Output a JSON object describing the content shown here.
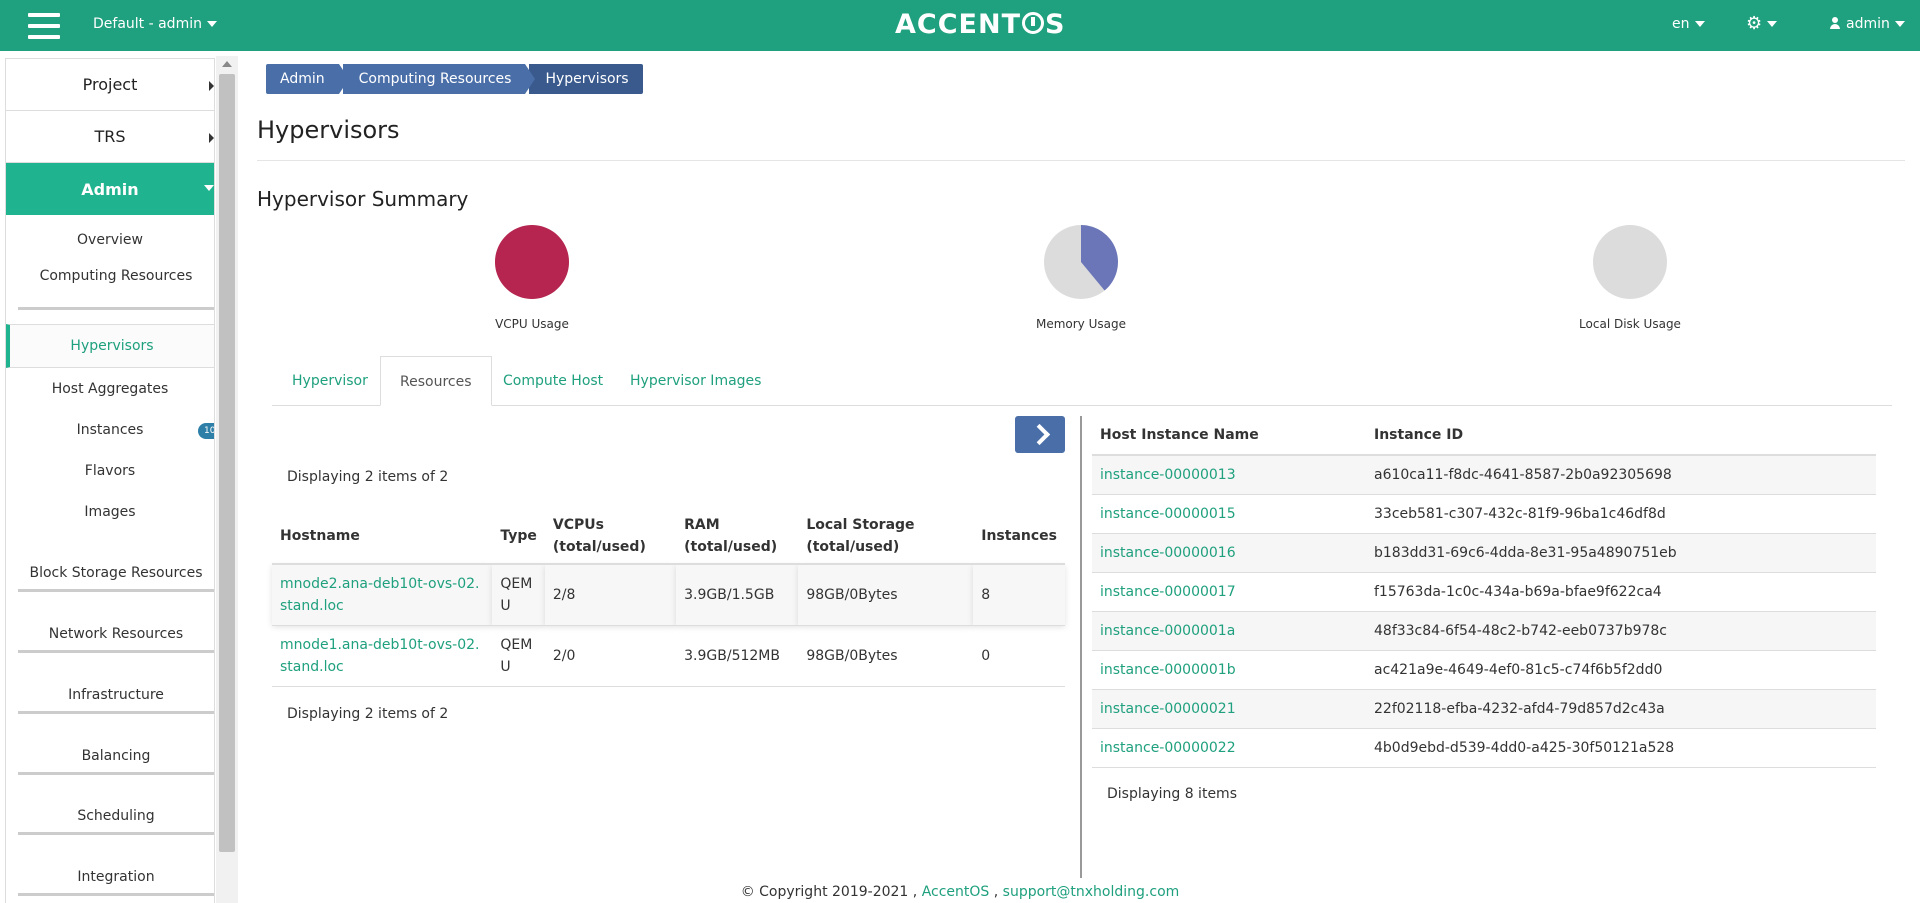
{
  "topbar": {
    "project": "Default - admin",
    "brand": "ACCENTOS",
    "brand_left": "ACCENT",
    "brand_right": "S",
    "language": "en",
    "user": "admin",
    "color": "#1fa07e"
  },
  "sidebar": {
    "sections": [
      {
        "label": "Project"
      },
      {
        "label": "TRS"
      }
    ],
    "active_section": "Admin",
    "items": [
      {
        "label": "Overview"
      },
      {
        "label": "Computing Resources"
      },
      {
        "label": "Hypervisors"
      },
      {
        "label": "Host Aggregates"
      },
      {
        "label": "Instances",
        "badge": "10"
      },
      {
        "label": "Flavors"
      },
      {
        "label": "Images"
      },
      {
        "label": "Block Storage Resources"
      },
      {
        "label": "Network Resources"
      },
      {
        "label": "Infrastructure"
      },
      {
        "label": "Balancing"
      },
      {
        "label": "Scheduling"
      },
      {
        "label": "Integration"
      }
    ]
  },
  "breadcrumb": [
    "Admin",
    "Computing Resources",
    "Hypervisors"
  ],
  "page_title": "Hypervisors",
  "summary": {
    "title": "Hypervisor Summary",
    "charts": [
      {
        "label": "VCPU Usage",
        "used_fraction": 1.0,
        "color": "#b5254f"
      },
      {
        "label": "Memory Usage",
        "used_fraction": 0.39,
        "color": "#6b76b8"
      },
      {
        "label": "Local Disk Usage",
        "used_fraction": 0.0,
        "color": "#6b76b8"
      }
    ]
  },
  "tabs": [
    "Hypervisor",
    "Resources",
    "Compute Host",
    "Hypervisor Images"
  ],
  "hypervisors": {
    "display_count": "Displaying 2 items of 2",
    "columns": [
      "Hostname",
      "Type",
      "VCPUs (total/used)",
      "RAM (total/used)",
      "Local Storage (total/used)",
      "Instances"
    ],
    "rows": [
      {
        "hostname": "mnode2.ana-deb10t-ovs-02.stand.loc",
        "type": "QEMU",
        "vcpus": "2/8",
        "ram": "3.9GB/1.5GB",
        "storage": "98GB/0Bytes",
        "instances": "8"
      },
      {
        "hostname": "mnode1.ana-deb10t-ovs-02.stand.loc",
        "type": "QEMU",
        "vcpus": "2/0",
        "ram": "3.9GB/512MB",
        "storage": "98GB/0Bytes",
        "instances": "0"
      }
    ]
  },
  "instances": {
    "columns": [
      "Host Instance Name",
      "Instance ID"
    ],
    "rows": [
      {
        "name": "instance-00000013",
        "id": "a610ca11-f8dc-4641-8587-2b0a92305698"
      },
      {
        "name": "instance-00000015",
        "id": "33ceb581-c307-432c-81f9-96ba1c46df8d"
      },
      {
        "name": "instance-00000016",
        "id": "b183dd31-69c6-4dda-8e31-95a4890751eb"
      },
      {
        "name": "instance-00000017",
        "id": "f15763da-1c0c-434a-b69a-bfae9f622ca4"
      },
      {
        "name": "instance-0000001a",
        "id": "48f33c84-6f54-48c2-b742-eeb0737b978c"
      },
      {
        "name": "instance-0000001b",
        "id": "ac421a9e-4649-4ef0-81c5-c74f6b5f2dd0"
      },
      {
        "name": "instance-00000021",
        "id": "22f02118-efba-4232-afd4-79d857d2c43a"
      },
      {
        "name": "instance-00000022",
        "id": "4b0d9ebd-d539-4dd0-a425-30f50121a528"
      }
    ],
    "display_count": "Displaying 8 items"
  },
  "footer": {
    "copyright": "© Copyright 2019-2021 ,",
    "product": "AccentOS",
    "separator": ",",
    "email": "support@tnxholding.com"
  }
}
